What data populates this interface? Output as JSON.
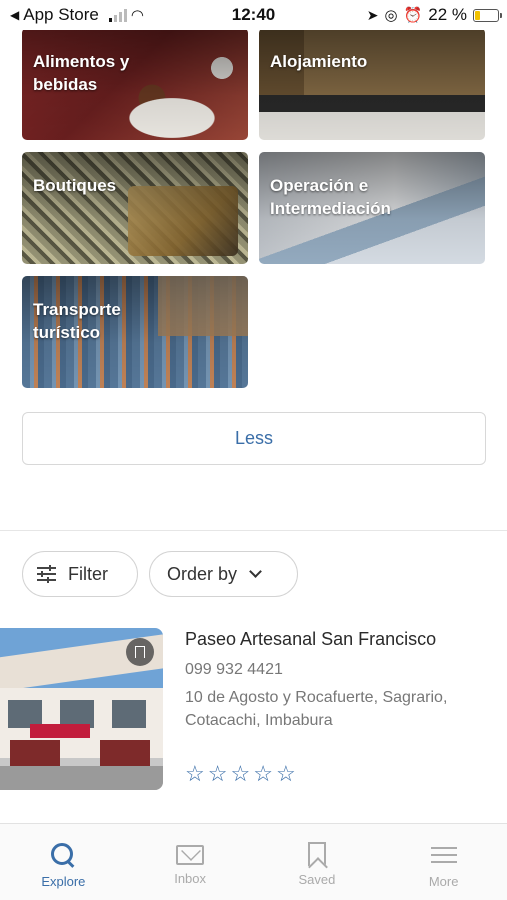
{
  "status_bar": {
    "back_app": "App Store",
    "time": "12:40",
    "battery": "22 %",
    "battery_level": 0.22
  },
  "categories": [
    {
      "label": "Alimentos y\nbebidas"
    },
    {
      "label": "Alojamiento"
    },
    {
      "label": "Boutiques"
    },
    {
      "label": "Operación e\nIntermediación"
    },
    {
      "label": "Transporte\nturístico"
    }
  ],
  "less_button": "Less",
  "controls": {
    "filter_label": "Filter",
    "order_label": "Order by"
  },
  "listing": {
    "name": "Paseo Artesanal San Francisco",
    "phone": "099 932 4421",
    "address": "10 de Agosto y Rocafuerte, Sagrario, Cotacachi, Imbabura",
    "rating": 0,
    "stars_max": 5,
    "star_glyph": "☆"
  },
  "bottom_nav": [
    {
      "label": "Explore",
      "icon": "search-icon",
      "active": true
    },
    {
      "label": "Inbox",
      "icon": "mail-icon",
      "active": false
    },
    {
      "label": "Saved",
      "icon": "bookmark-icon",
      "active": false
    },
    {
      "label": "More",
      "icon": "menu-icon",
      "active": false
    }
  ],
  "colors": {
    "accent": "#3a6ea8",
    "inactive": "#aaaaaa"
  }
}
